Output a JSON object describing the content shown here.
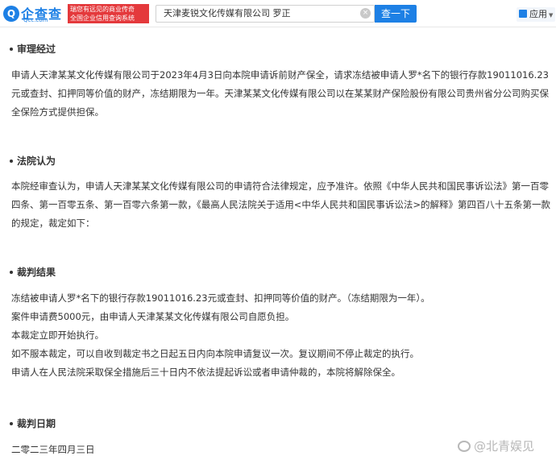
{
  "header": {
    "logo_mark": "Q",
    "logo_text": "企查查",
    "logo_domain": "Qcc.com",
    "slogan_line1": "瑞您有远见的商业传奇",
    "slogan_line2": "全国企业信用查询系统",
    "search_value": "天津麦锐文化传媒有限公司 罗正",
    "clear_icon": "×",
    "search_button": "查一下",
    "app_menu": "应用"
  },
  "sections": {
    "review": {
      "heading": "审理经过",
      "paragraph": "申请人天津某某文化传媒有限公司于2023年4月3日向本院申请诉前财产保全，请求冻结被申请人罗*名下的银行存款19011016.23元或查封、扣押同等价值的财产，冻结期限为一年。天津某某文化传媒有限公司以在某某财产保险股份有限公司贵州省分公司购买保全保险方式提供担保。"
    },
    "court_opinion": {
      "heading": "法院认为",
      "paragraph": "本院经审查认为，申请人天津某某文化传媒有限公司的申请符合法律规定，应予准许。依照《中华人民共和国民事诉讼法》第一百零四条、第一百零五条、第一百零六条第一款，《最高人民法院关于适用<中华人民共和国民事诉讼法>的解释》第四百八十五条第一款的规定，裁定如下："
    },
    "ruling": {
      "heading": "裁判结果",
      "lines": [
        "冻结被申请人罗*名下的银行存款19011016.23元或查封、扣押同等价值的财产。（冻结期限为一年）。",
        "案件申请费5000元，由申请人天津某某文化传媒有限公司自愿负担。",
        "本裁定立即开始执行。",
        "如不服本裁定，可以自收到裁定书之日起五日内向本院申请复议一次。复议期间不停止裁定的执行。",
        "申请人在人民法院采取保全措施后三十日内不依法提起诉讼或者申请仲裁的，本院将解除保全。"
      ]
    },
    "date": {
      "heading": "裁判日期",
      "value": "二零二三年四月三日"
    }
  },
  "watermark": "@北青娱见"
}
